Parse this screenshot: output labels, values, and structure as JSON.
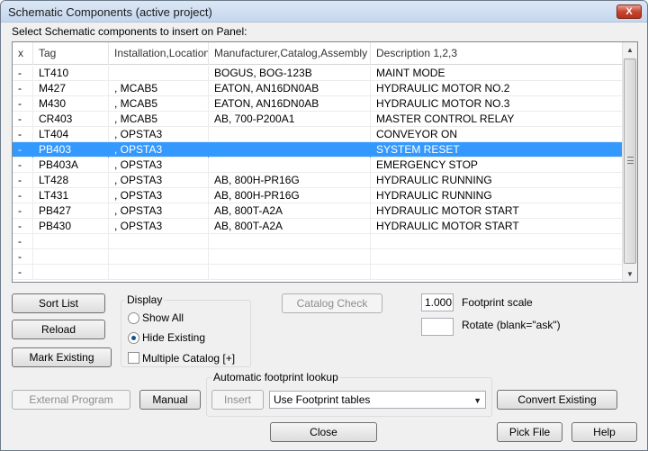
{
  "window": {
    "title": "Schematic Components (active project)",
    "close_glyph": "X"
  },
  "instruction": "Select Schematic components to insert on Panel:",
  "table": {
    "columns": [
      "x",
      "Tag",
      "Installation,Location",
      "Manufacturer,Catalog,Assembly",
      "Description 1,2,3"
    ],
    "rows": [
      [
        "-",
        "LT410",
        "",
        "BOGUS, BOG-123B",
        "MAINT MODE"
      ],
      [
        "-",
        "M427",
        ", MCAB5",
        "EATON, AN16DN0AB",
        "HYDRAULIC MOTOR NO.2"
      ],
      [
        "-",
        "M430",
        ", MCAB5",
        "EATON, AN16DN0AB",
        "HYDRAULIC MOTOR NO.3"
      ],
      [
        "-",
        "CR403",
        ", MCAB5",
        "AB, 700-P200A1",
        "MASTER CONTROL RELAY"
      ],
      [
        "-",
        "LT404",
        ", OPSTA3",
        "",
        "CONVEYOR ON"
      ],
      [
        "-",
        "PB403",
        ", OPSTA3",
        "",
        "SYSTEM RESET"
      ],
      [
        "-",
        "PB403A",
        ", OPSTA3",
        "",
        "EMERGENCY STOP"
      ],
      [
        "-",
        "LT428",
        ", OPSTA3",
        "AB, 800H-PR16G",
        "HYDRAULIC RUNNING"
      ],
      [
        "-",
        "LT431",
        ", OPSTA3",
        "AB, 800H-PR16G",
        "HYDRAULIC RUNNING"
      ],
      [
        "-",
        "PB427",
        ", OPSTA3",
        "AB, 800T-A2A",
        "HYDRAULIC MOTOR START"
      ],
      [
        "-",
        "PB430",
        ", OPSTA3",
        "AB, 800T-A2A",
        "HYDRAULIC MOTOR START"
      ],
      [
        "-",
        "",
        "",
        "",
        ""
      ],
      [
        "-",
        "",
        "",
        "",
        ""
      ],
      [
        "-",
        "",
        "",
        "",
        ""
      ]
    ],
    "selected_row": 5,
    "scroll_up_glyph": "▲",
    "scroll_down_glyph": "▼"
  },
  "buttons": {
    "sort_list": "Sort List",
    "reload": "Reload",
    "mark_existing": "Mark Existing",
    "catalog_check": "Catalog Check",
    "external_program": "External Program",
    "manual": "Manual",
    "insert": "Insert",
    "convert_existing": "Convert Existing",
    "close": "Close",
    "pick_file": "Pick File",
    "help": "Help"
  },
  "display": {
    "legend": "Display",
    "show_all": "Show All",
    "hide_existing": "Hide Existing",
    "selected": "hide_existing",
    "multiple_catalog": "Multiple Catalog [+]",
    "multiple_catalog_checked": false
  },
  "footprint": {
    "scale_value": "1.000",
    "scale_label": "Footprint scale",
    "rotate_value": "",
    "rotate_label": "Rotate (blank=\"ask\")"
  },
  "auto_lookup": {
    "legend": "Automatic footprint lookup",
    "combo_value": "Use Footprint tables",
    "combo_arrow": "▼"
  },
  "colors": {
    "selection": "#3399ff",
    "title_bar": "#c5d7ee",
    "close_red": "#c6452f"
  }
}
